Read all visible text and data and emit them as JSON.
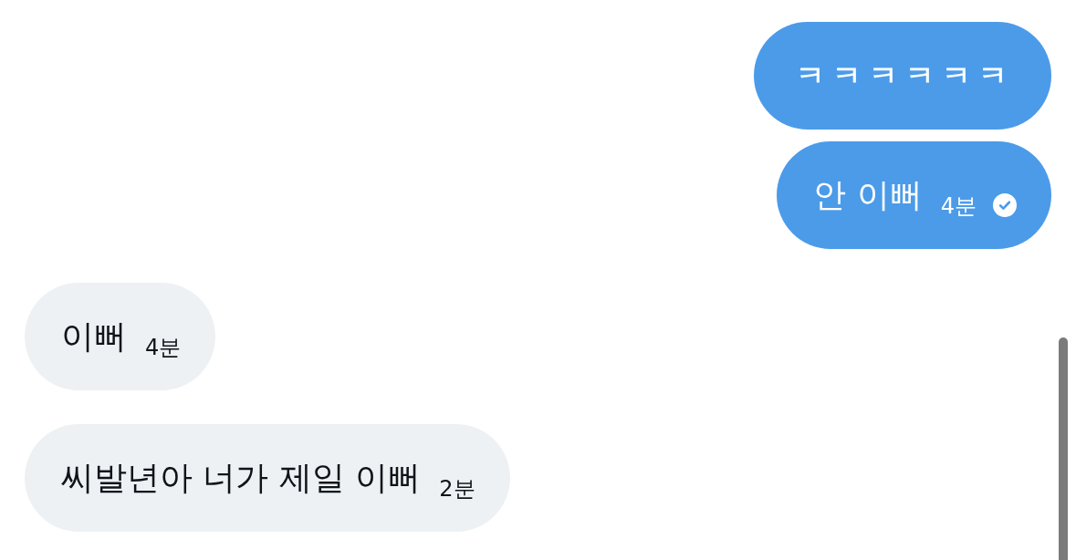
{
  "messages": [
    {
      "kind": "outgoing",
      "text": "ㅋㅋㅋㅋㅋㅋ"
    },
    {
      "kind": "outgoing",
      "text": "안 이뻐",
      "time": "4분",
      "read": true
    },
    {
      "kind": "incoming",
      "text": "이뻐",
      "time": "4분"
    },
    {
      "kind": "incoming",
      "text": "씨발년아 너가 제일 이뻐",
      "time": "2분"
    }
  ]
}
